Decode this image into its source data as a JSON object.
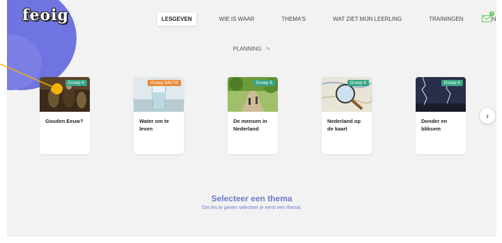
{
  "logo": {
    "text": "feoig"
  },
  "nav": {
    "items": [
      {
        "label": "LESGEVEN",
        "active": true
      },
      {
        "label": "WIE IS WAAR",
        "active": false
      },
      {
        "label": "THEMA'S",
        "active": false
      },
      {
        "label": "WAT ZIET MIJN LEERLING",
        "active": false
      },
      {
        "label": "TRAININGEN",
        "active": false
      },
      {
        "label": "INSTELLINGEN",
        "active": false
      }
    ],
    "mail_icon": "envelope-icon",
    "mail_badge": "0"
  },
  "planning": {
    "label": "PLANNING",
    "edit_icon": "pencil-icon"
  },
  "cards": [
    {
      "title": "Gouden Eeuw?",
      "badge": "Groep 6",
      "badge_color": "#36a584"
    },
    {
      "title": "Water om te leven",
      "badge": "Groep 5/6/7/8",
      "badge_color": "#e8893a"
    },
    {
      "title": "De mensen in Nederland",
      "badge": "Groep 6",
      "badge_color": "#36a584"
    },
    {
      "title": "Nederland op de kaart",
      "badge": "Groep 6",
      "badge_color": "#36a584"
    },
    {
      "title": "Donder en bliksem",
      "badge": "Groep 6",
      "badge_color": "#36a584"
    }
  ],
  "next_button": {
    "icon": "chevron-right-icon"
  },
  "empty_state": {
    "title": "Selecteer een thema",
    "subtitle": "Om les te geven selecteer je eerst een thema."
  },
  "colors": {
    "accent": "#6d7ac6",
    "blob": "#6f74e0",
    "pointer": "#f4b400"
  }
}
